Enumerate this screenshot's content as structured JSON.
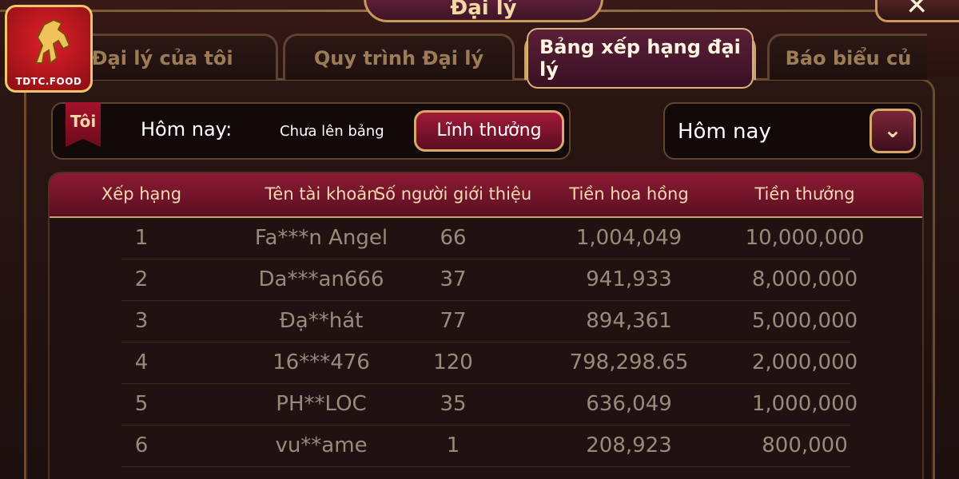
{
  "window": {
    "title": "Đại lý"
  },
  "logo": {
    "text": "TDTC.FOOD"
  },
  "tabs": [
    {
      "label": "Đại lý của tôi",
      "active": false
    },
    {
      "label": "Quy trình Đại lý",
      "active": false
    },
    {
      "label": "Bảng xếp hạng đại lý",
      "active": true
    },
    {
      "label": "Báo biểu củ",
      "active": false
    }
  ],
  "filter": {
    "badge": "Tôi",
    "today_label": "Hôm nay:",
    "rank_status": "Chưa lên bảng",
    "claim_label": "Lĩnh thưởng",
    "period_value": "Hôm nay"
  },
  "table": {
    "headers": [
      "Xếp hạng",
      "Tên tài khoản",
      "Số người giới thiệu",
      "Tiền hoa hồng",
      "Tiền thưởng"
    ],
    "rows": [
      [
        "1",
        "Fa***n Angel",
        "66",
        "1,004,049",
        "10,000,000"
      ],
      [
        "2",
        "Da***an666",
        "37",
        "941,933",
        "8,000,000"
      ],
      [
        "3",
        "Đạ**hát",
        "77",
        "894,361",
        "5,000,000"
      ],
      [
        "4",
        "16***476",
        "120",
        "798,298.65",
        "2,000,000"
      ],
      [
        "5",
        "PH**LOC",
        "35",
        "636,049",
        "1,000,000"
      ],
      [
        "6",
        "vu**ame",
        "1",
        "208,923",
        "800,000"
      ]
    ]
  },
  "colors": {
    "accent": "#8b1a33",
    "gold": "#caa06a",
    "text_muted": "#9a8a7c"
  }
}
